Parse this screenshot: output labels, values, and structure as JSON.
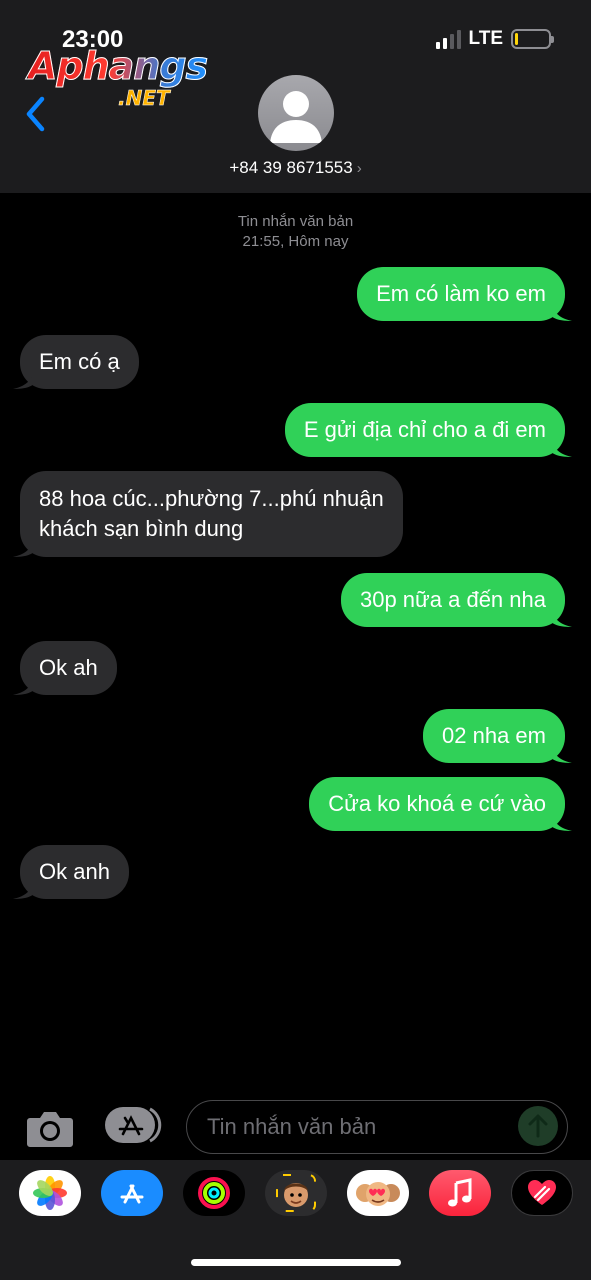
{
  "status_bar": {
    "time": "23:00",
    "network": "LTE"
  },
  "watermark": {
    "brand": "Aphangs",
    "suffix": ".NET"
  },
  "header": {
    "contact_number": "+84 39 8671553",
    "chevron": "›"
  },
  "conversation": {
    "type_label": "Tin nhắn văn bản",
    "timestamp": "21:55, Hôm nay",
    "messages": [
      {
        "direction": "out",
        "text": "Em có làm ko em"
      },
      {
        "direction": "in",
        "text": "Em có ạ"
      },
      {
        "direction": "out",
        "text": "E gửi địa chỉ cho a đi em"
      },
      {
        "direction": "in",
        "lines": [
          "88 hoa cúc...phường 7...phú nhuận",
          "khách sạn bình dung"
        ]
      },
      {
        "direction": "out",
        "text": "30p nữa a đến nha"
      },
      {
        "direction": "in",
        "text": "Ok ah"
      },
      {
        "direction": "out",
        "text": "02 nha em"
      },
      {
        "direction": "out",
        "text": "Cửa ko khoá e cứ vào"
      },
      {
        "direction": "in",
        "text": "Ok anh"
      }
    ]
  },
  "composer": {
    "placeholder": "Tin nhắn văn bản"
  },
  "app_tray": {
    "apps": [
      "photos-icon",
      "app-store-icon",
      "activity-icon",
      "memoji-icon",
      "animoji-stickers-icon",
      "music-icon",
      "digital-touch-icon"
    ]
  },
  "colors": {
    "outgoing": "#30d158",
    "incoming": "#2c2c2e",
    "header_bg": "#1c1c1e",
    "accent": "#0a84ff"
  }
}
